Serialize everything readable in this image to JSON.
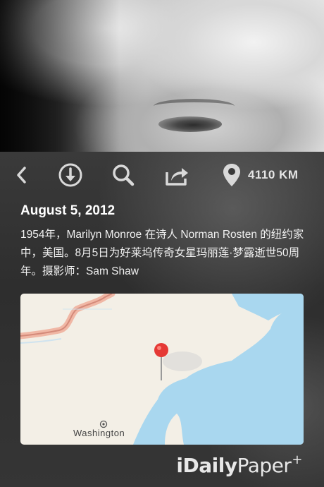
{
  "header": {
    "distance": "4110 KM"
  },
  "icons": {
    "back": "chevron-left-icon",
    "download": "download-icon",
    "search": "search-icon",
    "share": "share-icon",
    "location": "location-pin-icon"
  },
  "article": {
    "date": "August 5, 2012",
    "description": "1954年，Marilyn Monroe 在诗人 Norman Rosten 的纽约家中，美国。8月5日为好莱坞传奇女星玛丽莲·梦露逝世50周年。摄影师：Sam Shaw"
  },
  "map": {
    "city_label": "Washington"
  },
  "brand": {
    "name_bold": "iDaily",
    "name_light": "Paper",
    "suffix": "+"
  },
  "colors": {
    "background": "#2f2f2f",
    "map_land": "#f3efe6",
    "map_water": "#a9d7ef",
    "pin": "#e53935"
  }
}
